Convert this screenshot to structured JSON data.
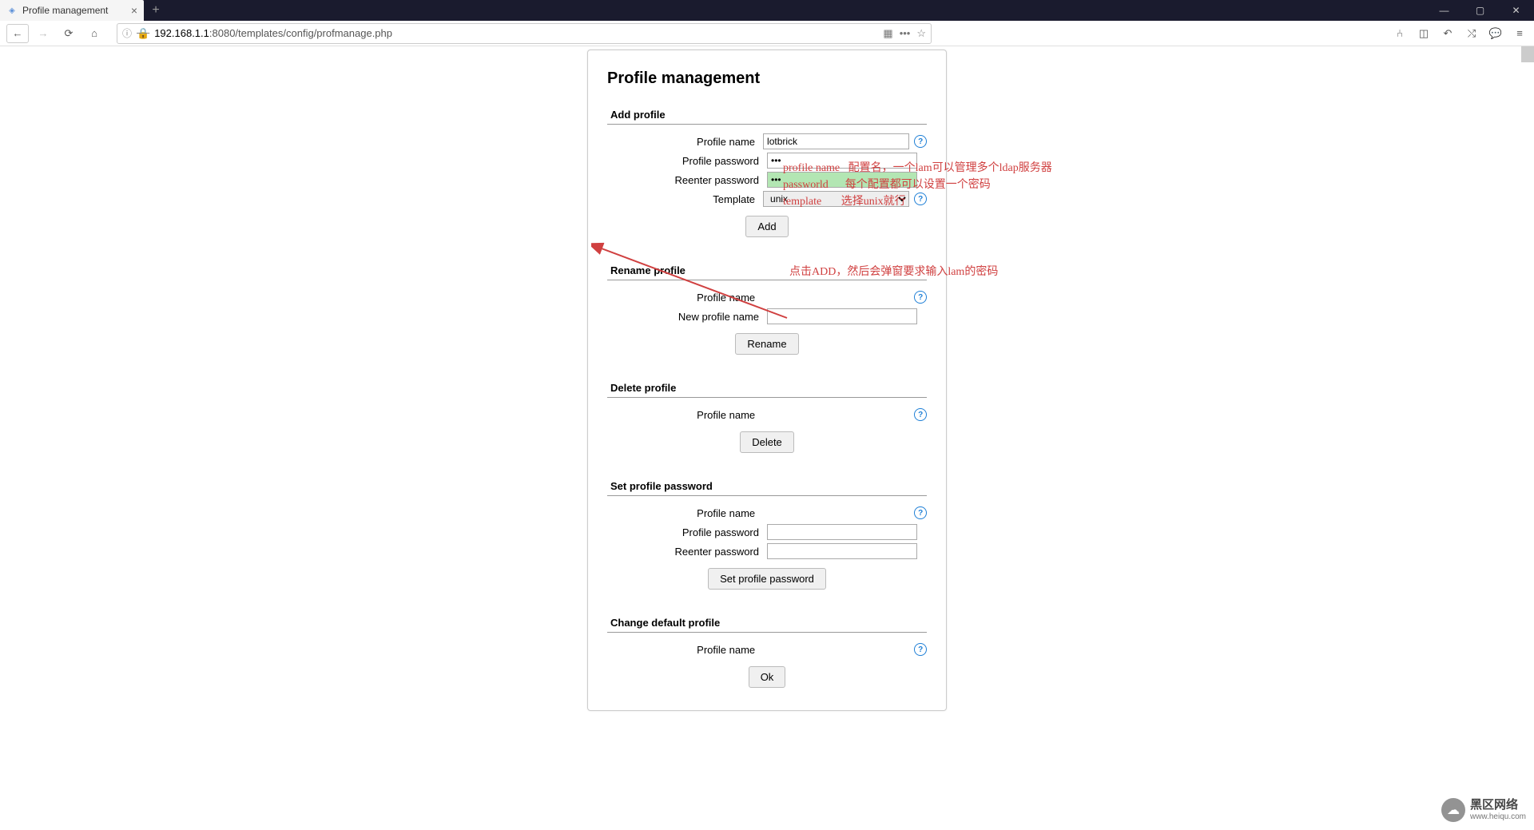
{
  "browser": {
    "tab_title": "Profile management",
    "url_host": "192.168.1.1",
    "url_port_path": ":8080/templates/config/profmanage.php"
  },
  "page": {
    "title": "Profile management",
    "sections": {
      "add": {
        "heading": "Add profile",
        "profile_name_label": "Profile name",
        "profile_name_value": "lotbrick",
        "password_label": "Profile password",
        "password_value": "•••",
        "reenter_label": "Reenter password",
        "reenter_value": "•••",
        "template_label": "Template",
        "template_value": "unix",
        "button": "Add"
      },
      "rename": {
        "heading": "Rename profile",
        "profile_name_label": "Profile name",
        "new_name_label": "New profile name",
        "button": "Rename"
      },
      "delete": {
        "heading": "Delete profile",
        "profile_name_label": "Profile name",
        "button": "Delete"
      },
      "setpw": {
        "heading": "Set profile password",
        "profile_name_label": "Profile name",
        "password_label": "Profile password",
        "reenter_label": "Reenter password",
        "button": "Set profile password"
      },
      "default": {
        "heading": "Change default profile",
        "profile_name_label": "Profile name",
        "button": "Ok"
      }
    }
  },
  "annotations": {
    "table": "profile name   配置名，一个lam可以管理多个ldap服务器\npassworld      每个配置都可以设置一个密码\ntemplate       选择unix就行",
    "add_note": "点击ADD，然后会弹窗要求输入lam的密码"
  },
  "watermark": {
    "cn": "黑区网络",
    "en": "www.heiqu.com"
  }
}
